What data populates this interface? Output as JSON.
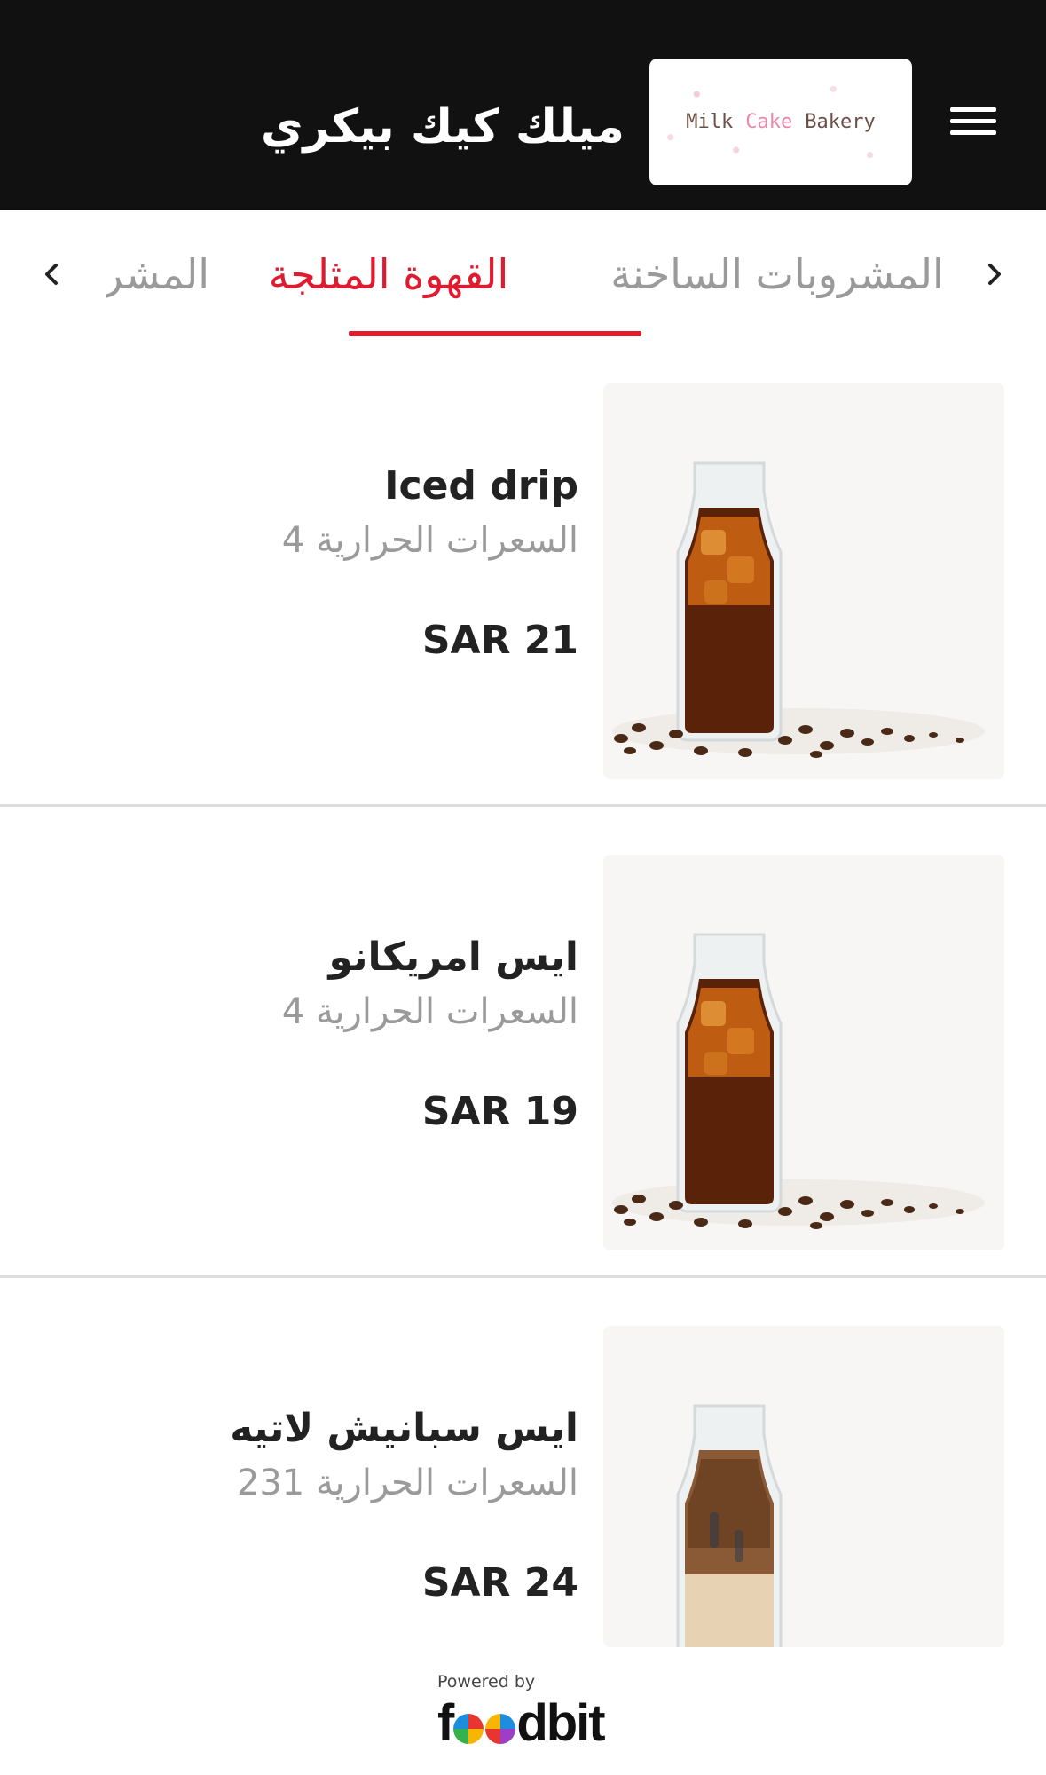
{
  "header": {
    "restaurant_name": "ميلك كيك بيكري",
    "logo": {
      "words": [
        "Milk",
        "Cake",
        "Bakery"
      ]
    },
    "menu_icon": "hamburger-menu-icon"
  },
  "tabs": {
    "items": [
      {
        "label": "المشروبات الساخنة",
        "active": false
      },
      {
        "label": "القهوة المثلجة",
        "active": true
      },
      {
        "label": "المشرو",
        "active": false
      }
    ],
    "prev_icon": "chevron-left-icon",
    "next_icon": "chevron-right-icon",
    "active_color": "#e01b2f"
  },
  "items": [
    {
      "title": "Iced drip",
      "calories": "السعرات الحرارية 4",
      "price": "SAR 21",
      "image": "iced-coffee-bottle"
    },
    {
      "title": "ايس امريكانو",
      "calories": "السعرات الحرارية 4",
      "price": "SAR 19",
      "image": "iced-coffee-bottle"
    },
    {
      "title": "ايس سبانيش لاتيه",
      "calories": "السعرات الحرارية 231",
      "price": "SAR 24",
      "image": "iced-latte-bottle"
    }
  ],
  "footer": {
    "powered_by": "Powered by",
    "brand": "foodbit"
  }
}
